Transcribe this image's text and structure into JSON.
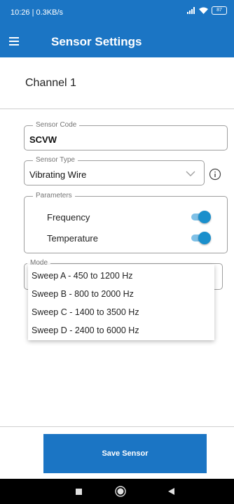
{
  "status_bar": {
    "time_text": "10:26 | 0.3KB/s",
    "battery_level": "87"
  },
  "app_bar": {
    "title": "Sensor Settings"
  },
  "channel_title": "Channel 1",
  "sensor_code": {
    "legend": "Sensor Code",
    "value": "SCVW"
  },
  "sensor_type": {
    "legend": "Sensor Type",
    "value": "Vibrating Wire"
  },
  "parameters": {
    "legend": "Parameters",
    "items": [
      {
        "label": "Frequency",
        "enabled": true
      },
      {
        "label": "Temperature",
        "enabled": true
      }
    ]
  },
  "mode": {
    "legend": "Mode",
    "options": [
      "Sweep A - 450 to 1200 Hz",
      "Sweep B - 800 to 2000 Hz",
      "Sweep C - 1400 to 3500 Hz",
      "Sweep D - 2400 to 6000 Hz"
    ]
  },
  "save_button": {
    "label": "Save Sensor"
  },
  "colors": {
    "primary": "#1b75c4",
    "toggle_on": "#1a8fcc"
  },
  "icons": [
    "menu-icon",
    "signal-icon",
    "wifi-icon",
    "battery-icon",
    "chevron-down-icon",
    "info-icon",
    "nav-recents-icon",
    "nav-home-icon",
    "nav-back-icon"
  ]
}
